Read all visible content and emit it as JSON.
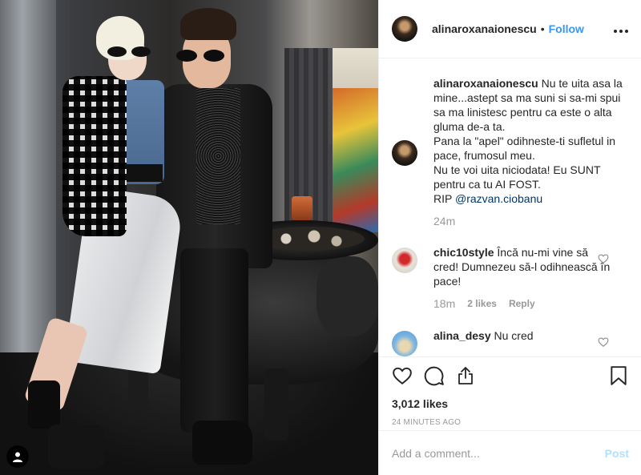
{
  "header": {
    "username": "alinaroxanaionescu",
    "separator": "•",
    "follow_label": "Follow",
    "more_icon": "more-horizontal-icon"
  },
  "caption": {
    "username": "alinaroxanaionescu",
    "text": " Nu te uita asa la mine...astept sa ma suni si sa-mi spui sa ma linistesc pentru ca este o alta gluma de-a ta.\nPana la \"apel\" odihneste-ti sufletul in pace, frumosul meu.\nNu te voi uita niciodata! Eu SUNT pentru ca tu AI FOST.\nRIP ",
    "mention": "@razvan.ciobanu",
    "time": "24m"
  },
  "comments": [
    {
      "username": "chic10style",
      "text": "Încă nu-mi vine să cred! Dumnezeu să-l odihnească în pace!",
      "time": "18m",
      "likes": "2 likes",
      "reply": "Reply"
    },
    {
      "username": "alina_desy",
      "text": "Nu cred",
      "time": "",
      "likes": "",
      "reply": ""
    }
  ],
  "actions": {
    "likes_count": "3,012 likes",
    "posted": "24 MINUTES AGO"
  },
  "add_comment": {
    "placeholder": "Add a comment...",
    "post_label": "Post"
  },
  "colors": {
    "accent": "#3897f0",
    "link": "#003569",
    "muted": "#999999",
    "post_disabled": "#b2dffc"
  }
}
